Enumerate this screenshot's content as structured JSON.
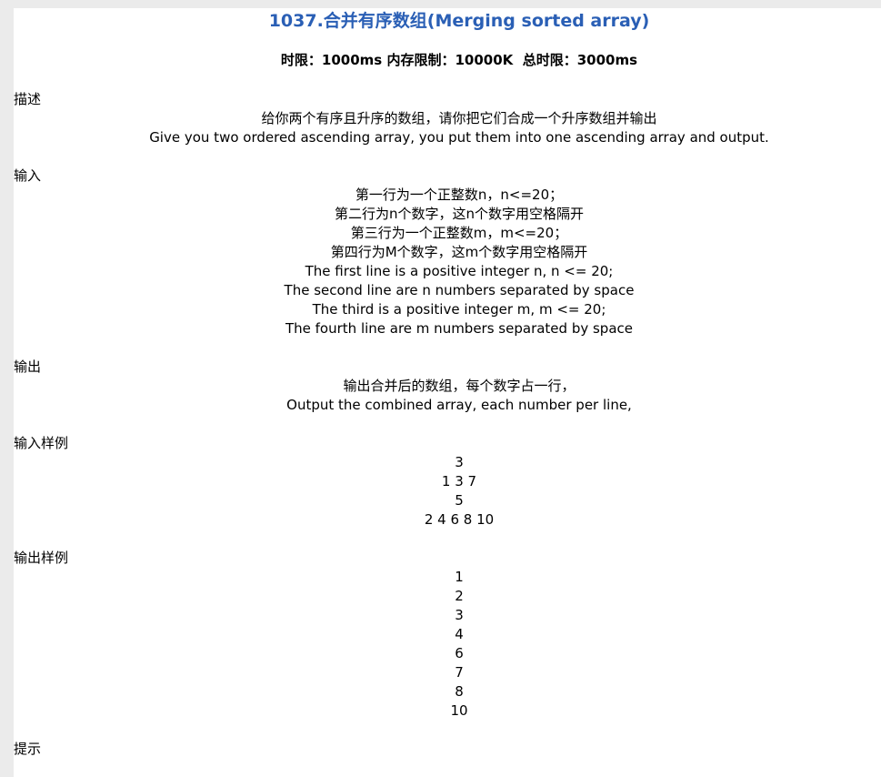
{
  "problem": {
    "title": "1037.合并有序数组(Merging sorted array)",
    "limits": {
      "time": "时限：1000ms",
      "memory": "内存限制：10000K",
      "total": "总时限：3000ms"
    }
  },
  "sections": {
    "description": {
      "heading": "描述",
      "lines": [
        "给你两个有序且升序的数组，请你把它们合成一个升序数组并输出",
        "Give you two ordered ascending array, you put them into one ascending array and output."
      ]
    },
    "input": {
      "heading": "输入",
      "lines": [
        "第一行为一个正整数n，n<=20；",
        "第二行为n个数字，这n个数字用空格隔开",
        "第三行为一个正整数m，m<=20；",
        "第四行为M个数字，这m个数字用空格隔开",
        "The first line is a positive integer n, n <= 20;",
        "The second line are n numbers separated by space",
        "The third is a positive integer m, m <= 20;",
        "The fourth line are m numbers separated by space"
      ]
    },
    "output": {
      "heading": "输出",
      "lines": [
        "输出合并后的数组，每个数字占一行，",
        "Output the combined array, each number per line,"
      ]
    },
    "sample_input": {
      "heading": "输入样例",
      "lines": [
        "3",
        "1 3 7",
        "5",
        "2 4 6 8 10"
      ]
    },
    "sample_output": {
      "heading": "输出样例",
      "lines": [
        "1",
        "2",
        "3",
        "4",
        "6",
        "7",
        "8",
        "10"
      ]
    },
    "hint": {
      "heading": "提示"
    }
  },
  "colors": {
    "title": "#2a5fb5",
    "page_background": "#ffffff",
    "outer_background": "#ebebeb"
  }
}
